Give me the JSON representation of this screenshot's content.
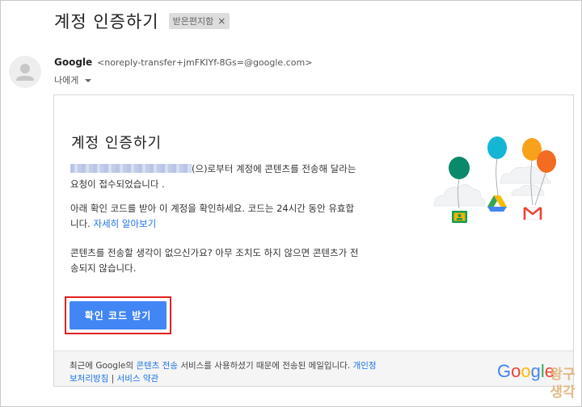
{
  "email": {
    "subject": "계정 인증하기",
    "label_chip": "받은편지함",
    "label_chip_close": "×",
    "sender_name": "Google",
    "sender_email": "<noreply-transfer+jmFKIYf-8Gs=@google.com>",
    "recipient": "나에게"
  },
  "card": {
    "title": "계정 인증하기",
    "p1_text": "(으)로부터 계정에 콘텐츠를 전송해 달라는 요청이 접수되었습니다 .",
    "p2_text": "아래 확인 코드를 받아 이 계정을 확인하세요. 코드는 24시간 동안 유효합니다.",
    "p2_link": "자세히 알아보기",
    "p3_text": "콘텐츠를 전송할 생각이 없으신가요? 아무 조치도 하지 않으면 콘텐츠가 전송되지 않습니다.",
    "cta_label": "확인 코드 받기"
  },
  "footer": {
    "text_before": "최근에 Google의 ",
    "transfer_link": "콘텐츠 전송",
    "text_after": " 서비스를 사용하셨기 때문에 전송된 메일입니다. ",
    "privacy_link": "개인정보처리방침",
    "separator": " | ",
    "terms_link": "서비스 약관",
    "logo": [
      "G",
      "o",
      "o",
      "g",
      "l",
      "e"
    ]
  },
  "watermark": [
    "왕구",
    "생각"
  ],
  "colors": {
    "google_blue": "#4285F4",
    "google_red": "#EA4335",
    "google_yellow": "#FBBC05",
    "google_green": "#34A853",
    "link": "#1A73E8",
    "highlight": "#E0201F"
  },
  "icons": {
    "avatar": "person-icon",
    "recipient_caret": "caret-down-icon",
    "illustration": [
      "balloon-classroom-icon",
      "balloon-drive-icon",
      "balloon-gmail-icon"
    ]
  }
}
